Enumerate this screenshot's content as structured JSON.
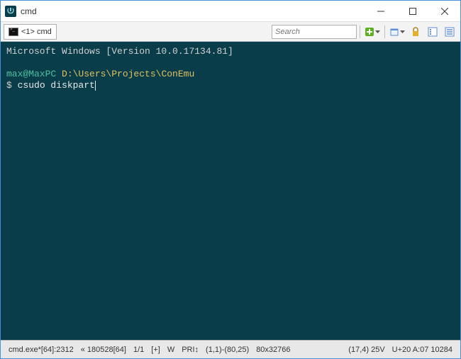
{
  "window": {
    "title": "cmd"
  },
  "toolbar": {
    "tabs": [
      {
        "label": "<1> cmd"
      }
    ],
    "search_placeholder": "Search"
  },
  "terminal": {
    "version_line": "Microsoft Windows [Version 10.0.17134.81]",
    "prompt_user": "max@MaxPC",
    "prompt_path": " D:\\Users\\Projects\\ConEmu",
    "prompt_symbol": "$ ",
    "command": "csudo diskpart"
  },
  "status": {
    "proc": "cmd.exe*[64]:2312",
    "build": "« 180528[64]",
    "page": "1/1",
    "plus": "[+]",
    "mode": "W",
    "pri": "PRI↕",
    "range": "(1,1)-(80,25)",
    "size": "80x32766",
    "cursor": "(17,4) 25V",
    "enc": "U+20 A:07  10284"
  }
}
